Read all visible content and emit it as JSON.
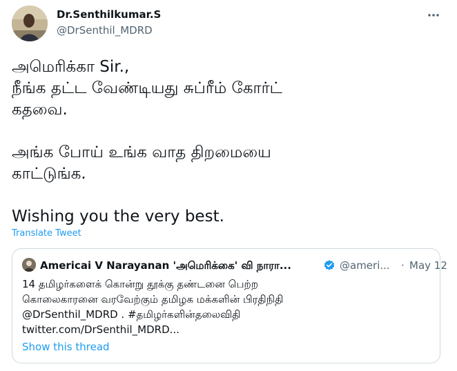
{
  "author": {
    "name": "Dr.Senthilkumar.S",
    "handle": "@DrSenthil_MDRD"
  },
  "tweet": {
    "lines": [
      "அமெரிக்கா Sir.,",
      "நீங்க தட்ட வேண்டியது சுப்ரீம் கோர்ட்",
      "கதவை.",
      "அங்க போய் உங்க வாத திறமையை",
      "காட்டுங்க.",
      "Wishing you the very best."
    ]
  },
  "translate_label": "Translate Tweet",
  "quoted": {
    "name": "Americai V Narayanan 'அமெரிக்கை' வி நாரா...",
    "handle": "@ameri...",
    "separator": "·",
    "date": "May 12",
    "lines": [
      "14 தமிழர்களைக் கொன்று தூக்கு தண்டனை பெற்ற",
      "கொலைகாரனை வரவேற்கும் தமிழக மக்களின் பிரதிநிதி",
      "@DrSenthil_MDRD . #தமிழர்களின்தலைவிதி",
      "twitter.com/DrSenthil_MDRD..."
    ],
    "show_thread": "Show this thread"
  },
  "icons": {
    "more": "more-dots-icon",
    "verified": "verified-badge-icon"
  },
  "colors": {
    "link": "#1d9bf0",
    "secondary_text": "#536471",
    "primary_text": "#0f1419",
    "border": "#cfd9de"
  }
}
